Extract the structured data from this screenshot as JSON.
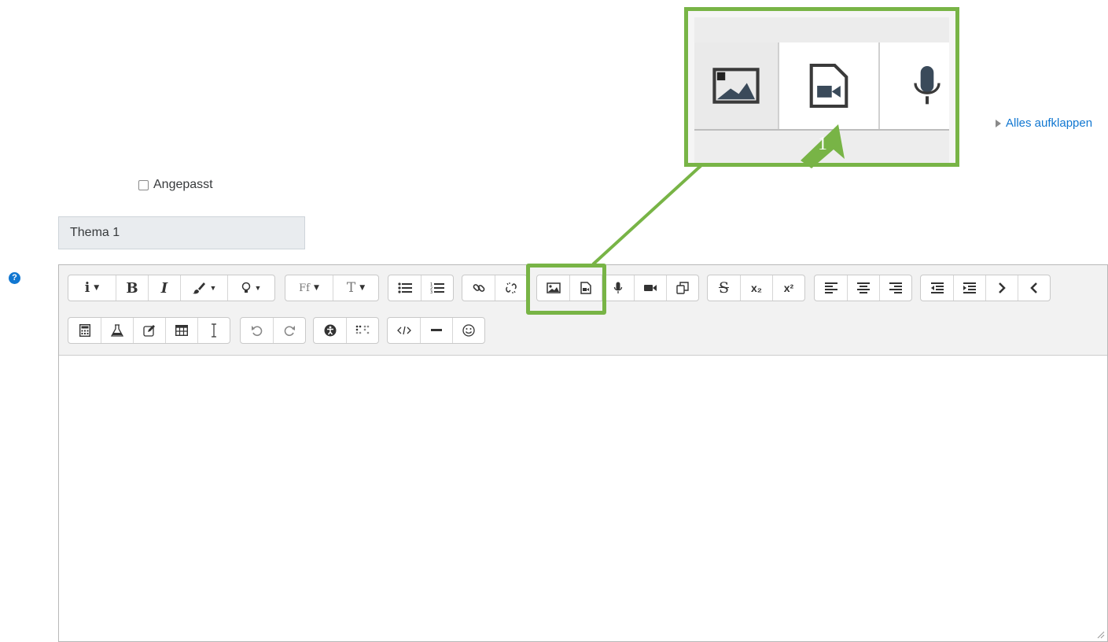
{
  "expand_all": "Alles aufklappen",
  "custom_checkbox": {
    "label": "Angepasst",
    "checked": false
  },
  "title_field": {
    "value": "Thema 1"
  },
  "callout_badge": "1",
  "colors": {
    "accent_green": "#78b446",
    "link_blue": "#1177d1"
  },
  "toolbar": {
    "row1": [
      {
        "group": "style",
        "buttons": [
          "info-menu",
          "bold",
          "italic",
          "color-menu",
          "highlight-menu"
        ],
        "labels": [
          "i",
          "B",
          "I"
        ]
      },
      {
        "group": "font",
        "buttons": [
          "font-family-menu",
          "font-size-menu"
        ],
        "labels": [
          "Ff",
          "T"
        ]
      },
      {
        "group": "lists",
        "buttons": [
          "unordered-list",
          "ordered-list"
        ]
      },
      {
        "group": "links",
        "buttons": [
          "link",
          "unlink"
        ]
      },
      {
        "group": "files",
        "buttons": [
          "insert-image",
          "insert-media"
        ]
      },
      {
        "group": "recording",
        "buttons": [
          "record-audio",
          "record-video",
          "manage-files"
        ]
      },
      {
        "group": "script",
        "buttons": [
          "strikethrough",
          "subscript",
          "superscript"
        ],
        "labels": [
          "x₂",
          "x²"
        ]
      },
      {
        "group": "align",
        "buttons": [
          "align-left",
          "align-center",
          "align-right"
        ]
      },
      {
        "group": "indent",
        "buttons": [
          "outdent",
          "indent",
          "rtl",
          "ltr"
        ]
      }
    ],
    "row2": [
      {
        "group": "math",
        "buttons": [
          "equation",
          "chemistry",
          "generico",
          "table",
          "text-cursor"
        ]
      },
      {
        "group": "history",
        "buttons": [
          "undo",
          "redo"
        ]
      },
      {
        "group": "accessibility",
        "buttons": [
          "accessibility-checker",
          "screenreader-helper"
        ]
      },
      {
        "group": "other",
        "buttons": [
          "html-source",
          "horizontal-rule",
          "emoticon"
        ]
      }
    ]
  },
  "callout_icons": [
    "insert-image",
    "insert-media",
    "record-audio"
  ]
}
